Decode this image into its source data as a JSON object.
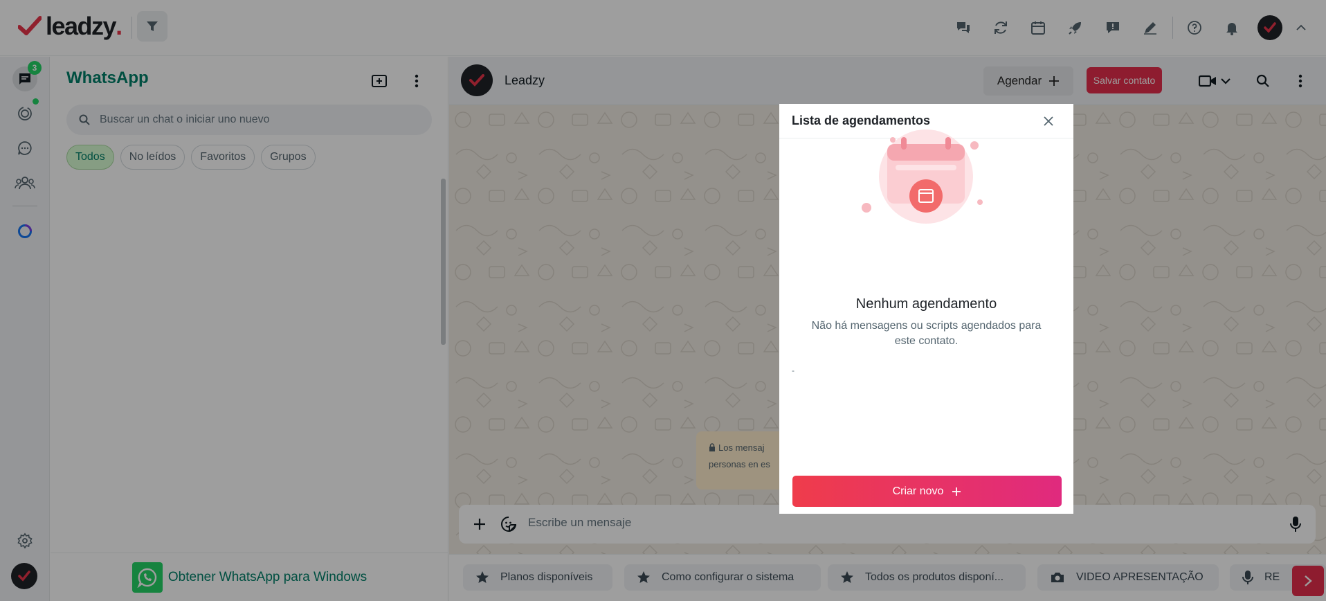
{
  "topbar": {
    "logo_text": "leadzy",
    "logo_dot": ".",
    "icons": [
      "chats-icon",
      "refresh-icon",
      "calendar-icon",
      "rocket-icon",
      "chat-alert-icon",
      "pen-icon",
      "help-icon",
      "bell-icon",
      "chevron-up-icon"
    ]
  },
  "rail": {
    "unread_badge": "3",
    "items": [
      "chats-icon",
      "status-icon",
      "channels-icon",
      "communities-icon",
      "meta-ai-icon"
    ],
    "bottom": [
      "settings-icon"
    ]
  },
  "chat_list": {
    "title": "WhatsApp",
    "search_placeholder": "Buscar un chat o iniciar uno nuevo",
    "filters": [
      "Todos",
      "No leídos",
      "Favoritos",
      "Grupos"
    ],
    "active_filter": "Todos",
    "get_app_text": "Obtener WhatsApp para Windows"
  },
  "conversation": {
    "contact_name": "Leadzy",
    "agendar_label": "Agendar",
    "salvar_label": "Salvar contato",
    "encryption_line1": "Los mensaj",
    "encryption_line2": "personas en es",
    "composer_placeholder": "Escribe un mensaje",
    "quick_replies": [
      {
        "icon": "star-icon",
        "label": "Planos disponíveis"
      },
      {
        "icon": "star-icon",
        "label": "Como configurar o sistema"
      },
      {
        "icon": "star-icon",
        "label": "Todos os produtos disponí..."
      },
      {
        "icon": "camera-icon",
        "label": "VIDEO APRESENTAÇÃO"
      },
      {
        "icon": "mic-icon",
        "label": "RE"
      }
    ]
  },
  "schedule_panel": {
    "title": "Lista de agendamentos",
    "empty_title": "Nenhum agendamento",
    "empty_desc": "Não há mensagens ou scripts agendados para este contato.",
    "marker": "-",
    "create_label": "Criar novo"
  },
  "colors": {
    "brand_red": "#e8344a",
    "whatsapp_green": "#008069",
    "badge_green": "#25d366",
    "button_gradient_start": "#ef3c4b",
    "button_gradient_end": "#e02a7e",
    "overlay": "rgba(0,0,0,0.38)"
  }
}
